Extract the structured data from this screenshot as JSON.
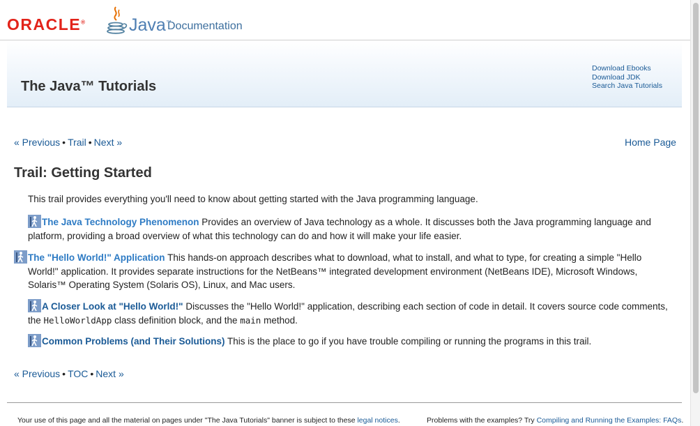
{
  "header": {
    "oracle_logo": "ORACLE",
    "java_logo": "Java",
    "documentation": "Documentation"
  },
  "banner": {
    "title": "The Java™ Tutorials",
    "links": [
      "Download Ebooks",
      "Download JDK",
      "Search Java Tutorials"
    ]
  },
  "nav_top": {
    "previous": "« Previous",
    "trail": "Trail",
    "next": "Next »",
    "home": "Home Page"
  },
  "page": {
    "title": "Trail: Getting Started",
    "intro": "This trail provides everything you'll need to know about getting started with the Java programming language."
  },
  "lessons": [
    {
      "title": "The Java Technology Phenomenon",
      "text": " Provides an overview of Java technology as a whole. It discusses both the Java programming language and platform, providing a broad overview of what this technology can do and how it will make your life easier."
    },
    {
      "title": "The \"Hello World!\" Application",
      "text": " This hands-on approach describes what to download, what to install, and what to type, for creating a simple \"Hello World!\" application. It provides separate instructions for the NetBeans™ integrated development environment (NetBeans IDE), Microsoft Windows, Solaris™ Operating System (Solaris OS), Linux, and Mac users."
    },
    {
      "title": "A Closer Look at \"Hello World!\"",
      "text_1": " Discusses the \"Hello World!\" application, describing each section of code in detail. It covers source code comments, the ",
      "code_1": "HelloWorldApp",
      "text_2": " class definition block, and the ",
      "code_2": "main",
      "text_3": " method."
    },
    {
      "title": "Common Problems (and Their Solutions)",
      "text": " This is the place to go if you have trouble compiling or running the programs in this trail."
    }
  ],
  "nav_bottom": {
    "previous": "« Previous",
    "toc": "TOC",
    "next": "Next »"
  },
  "footer": {
    "left_text": "Your use of this page and all the material on pages under \"The Java Tutorials\" banner is subject to these ",
    "left_link": "legal notices",
    "left_end": ".",
    "right_text": "Problems with the examples? Try ",
    "right_link": "Compiling and Running the Examples: FAQs",
    "right_end": "."
  },
  "colors": {
    "oracle_red": "#e2231a",
    "link": "#1a5a96",
    "java_blue": "#4f7fb3",
    "lesson_title": "#2e7bc4"
  },
  "icons": [
    "java-cup-icon",
    "trail-hiker-icon"
  ]
}
